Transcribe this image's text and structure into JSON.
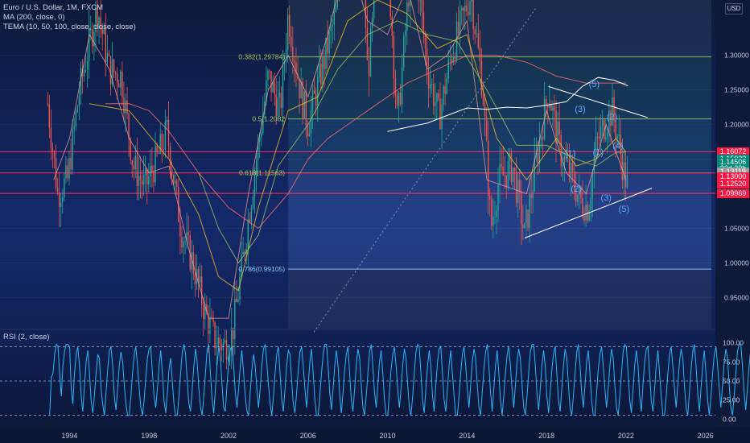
{
  "header": {
    "title": "Euro / U.S. Dollar, 1M, FXCM",
    "indicators": [
      "MA (200, close, 0)",
      "TEMA (10, 50, 100, close, close, close)"
    ],
    "currency": "USD"
  },
  "rsi_panel": {
    "label": "RSI (2, close)"
  },
  "colors": {
    "background": "#0d1a3a",
    "candle_up": "#26a69a",
    "candle_down": "#ef5350",
    "red_line": "#ff2b5e",
    "green_fib": "#9ccc65",
    "white_trend": "#ffffff",
    "rsi_line": "#29b6f6",
    "wave_label": "#5fa8ff"
  },
  "fib_labels": [
    {
      "text": "0.382(1.29784)",
      "price": 1.29784
    },
    {
      "text": "0.5(1.2082",
      "price": 1.2082
    },
    {
      "text": "0.618(1.11563)",
      "price": 1.1301
    },
    {
      "text": "0.786(0.99105)",
      "price": 0.99105
    }
  ],
  "price_tags": [
    {
      "text": "1.16072",
      "price": 1.16072,
      "bg": "#ff1744"
    },
    {
      "text": "1.15023",
      "price": 1.15023,
      "bg": "#00897b"
    },
    {
      "text": "1.14506",
      "price": 1.14506,
      "bg": "#00897b"
    },
    {
      "text": "23d 20h",
      "price": 1.1365,
      "bg": "#00897b"
    },
    {
      "text": "1.13119",
      "price": 1.13119,
      "bg": "#9e9e9e"
    },
    {
      "text": "1.13000",
      "price": 1.1243,
      "bg": "#ff1744"
    },
    {
      "text": "1.12520",
      "price": 1.1143,
      "bg": "#ff1744"
    },
    {
      "text": "1.09969",
      "price": 1.1005,
      "bg": "#ff1744"
    }
  ],
  "wave_labels": [
    {
      "text": "(5)",
      "x": 2020.4,
      "y": 1.254
    },
    {
      "text": "(3)",
      "x": 2019.7,
      "y": 1.218
    },
    {
      "text": "(2)",
      "x": 2021.3,
      "y": 1.207
    },
    {
      "text": "(1)",
      "x": 2019.2,
      "y": 1.154
    },
    {
      "text": "(1)",
      "x": 2020.6,
      "y": 1.156
    },
    {
      "text": "(4)",
      "x": 2021.6,
      "y": 1.165
    },
    {
      "text": "(2)",
      "x": 2019.5,
      "y": 1.103
    },
    {
      "text": "(3)",
      "x": 2021.0,
      "y": 1.09
    },
    {
      "text": "(5)",
      "x": 2021.9,
      "y": 1.074
    }
  ],
  "chart_data": [
    {
      "type": "candlestick",
      "title": "Euro / U.S. Dollar, 1M, FXCM",
      "xlim": [
        1990.5,
        2026.5
      ],
      "ylim": [
        0.905,
        1.38
      ],
      "x_ticks": [
        1994,
        1998,
        2002,
        2006,
        2010,
        2014,
        2018,
        2022,
        2026
      ],
      "y_ticks": [
        0.95,
        1.0,
        1.05,
        1.1,
        1.15,
        1.2,
        1.25,
        1.3
      ],
      "y_tick_labels": [
        "0.95000",
        "1.00000",
        "1.05000",
        "1.10000",
        "1.15000",
        "1.20000",
        "1.25000",
        "1.30000"
      ],
      "price_path": [
        [
          1992.9,
          1.23
        ],
        [
          1993.4,
          1.1
        ],
        [
          1993.9,
          1.12
        ],
        [
          1994.5,
          1.25
        ],
        [
          1995.1,
          1.33
        ],
        [
          1995.4,
          1.37
        ],
        [
          1996.0,
          1.28
        ],
        [
          1996.6,
          1.27
        ],
        [
          1997.2,
          1.14
        ],
        [
          1997.8,
          1.11
        ],
        [
          1998.4,
          1.15
        ],
        [
          1998.9,
          1.19
        ],
        [
          1999.6,
          1.05
        ],
        [
          2000.2,
          1.0
        ],
        [
          2000.8,
          0.93
        ],
        [
          2001.3,
          0.89
        ],
        [
          2001.8,
          0.88
        ],
        [
          2002.2,
          0.9
        ],
        [
          2002.7,
          1.0
        ],
        [
          2003.3,
          1.13
        ],
        [
          2004.0,
          1.27
        ],
        [
          2004.6,
          1.22
        ],
        [
          2005.0,
          1.36
        ],
        [
          2005.6,
          1.25
        ],
        [
          2006.0,
          1.2
        ],
        [
          2006.7,
          1.28
        ],
        [
          2007.4,
          1.36
        ],
        [
          2008.0,
          1.47
        ],
        [
          2008.6,
          1.57
        ],
        [
          2009.0,
          1.27
        ],
        [
          2009.6,
          1.45
        ],
        [
          2009.9,
          1.5
        ],
        [
          2010.5,
          1.2
        ],
        [
          2011.3,
          1.47
        ],
        [
          2012.0,
          1.28
        ],
        [
          2012.6,
          1.21
        ],
        [
          2013.2,
          1.3
        ],
        [
          2014.2,
          1.39
        ],
        [
          2014.8,
          1.25
        ],
        [
          2015.2,
          1.05
        ],
        [
          2015.6,
          1.12
        ],
        [
          2016.3,
          1.14
        ],
        [
          2016.9,
          1.04
        ],
        [
          2017.5,
          1.15
        ],
        [
          2018.1,
          1.25
        ],
        [
          2018.7,
          1.16
        ],
        [
          2019.3,
          1.12
        ],
        [
          2019.7,
          1.09
        ],
        [
          2020.1,
          1.08
        ],
        [
          2020.5,
          1.17
        ],
        [
          2020.9,
          1.2
        ],
        [
          2021.3,
          1.22
        ],
        [
          2021.6,
          1.18
        ],
        [
          2021.9,
          1.13
        ],
        [
          2022.1,
          1.11
        ]
      ],
      "ma200_path": [
        [
          1995.8,
          1.23
        ],
        [
          1997.0,
          1.23
        ],
        [
          1998.0,
          1.22
        ],
        [
          1999.0,
          1.19
        ],
        [
          2000.5,
          1.13
        ],
        [
          2002.0,
          1.08
        ],
        [
          2003.5,
          1.05
        ],
        [
          2005.0,
          1.1
        ],
        [
          2006.0,
          1.15
        ],
        [
          2007.0,
          1.18
        ],
        [
          2008.0,
          1.2
        ],
        [
          2009.5,
          1.23
        ],
        [
          2011.0,
          1.26
        ],
        [
          2012.5,
          1.28
        ],
        [
          2014.0,
          1.3
        ],
        [
          2015.5,
          1.3
        ],
        [
          2017.0,
          1.29
        ],
        [
          2018.5,
          1.27
        ],
        [
          2020.0,
          1.26
        ],
        [
          2021.0,
          1.26
        ],
        [
          2022.0,
          1.26
        ]
      ],
      "tema_paths": [
        [
          [
            1993.2,
            1.12
          ],
          [
            1994.0,
            1.18
          ],
          [
            1995.0,
            1.33
          ],
          [
            1996.0,
            1.28
          ],
          [
            1997.0,
            1.18
          ],
          [
            1998.0,
            1.13
          ],
          [
            1999.0,
            1.14
          ],
          [
            2000.0,
            1.02
          ],
          [
            2001.0,
            0.92
          ],
          [
            2002.0,
            0.92
          ],
          [
            2003.0,
            1.1
          ],
          [
            2004.0,
            1.25
          ],
          [
            2005.0,
            1.3
          ],
          [
            2006.0,
            1.24
          ],
          [
            2007.0,
            1.33
          ],
          [
            2008.0,
            1.45
          ],
          [
            2009.0,
            1.35
          ],
          [
            2010.0,
            1.33
          ],
          [
            2011.0,
            1.4
          ],
          [
            2012.0,
            1.28
          ],
          [
            2013.0,
            1.3
          ],
          [
            2014.0,
            1.35
          ],
          [
            2015.0,
            1.12
          ],
          [
            2016.0,
            1.11
          ],
          [
            2017.0,
            1.1
          ],
          [
            2018.0,
            1.22
          ],
          [
            2019.0,
            1.13
          ],
          [
            2020.0,
            1.1
          ],
          [
            2021.0,
            1.2
          ],
          [
            2022.0,
            1.12
          ]
        ],
        [
          [
            1995.0,
            1.23
          ],
          [
            1997.0,
            1.22
          ],
          [
            1999.0,
            1.15
          ],
          [
            2000.5,
            1.07
          ],
          [
            2001.5,
            0.98
          ],
          [
            2002.5,
            0.96
          ],
          [
            2003.5,
            1.08
          ],
          [
            2005.0,
            1.22
          ],
          [
            2006.5,
            1.24
          ],
          [
            2008.0,
            1.35
          ],
          [
            2009.5,
            1.38
          ],
          [
            2011.0,
            1.36
          ],
          [
            2012.5,
            1.31
          ],
          [
            2014.0,
            1.33
          ],
          [
            2015.5,
            1.18
          ],
          [
            2017.0,
            1.12
          ],
          [
            2018.5,
            1.18
          ],
          [
            2019.5,
            1.14
          ],
          [
            2020.5,
            1.15
          ],
          [
            2021.5,
            1.18
          ],
          [
            2022.0,
            1.16
          ]
        ],
        [
          [
            2000.5,
            1.13
          ],
          [
            2001.5,
            1.05
          ],
          [
            2002.5,
            1.0
          ],
          [
            2003.5,
            1.04
          ],
          [
            2004.5,
            1.14
          ],
          [
            2006.0,
            1.2
          ],
          [
            2007.5,
            1.28
          ],
          [
            2009.0,
            1.33
          ],
          [
            2010.5,
            1.35
          ],
          [
            2012.0,
            1.33
          ],
          [
            2013.5,
            1.32
          ],
          [
            2015.0,
            1.25
          ],
          [
            2016.5,
            1.17
          ],
          [
            2018.0,
            1.17
          ],
          [
            2019.5,
            1.15
          ],
          [
            2020.5,
            1.14
          ],
          [
            2021.5,
            1.16
          ],
          [
            2022.0,
            1.16
          ]
        ]
      ],
      "horizontal_levels": [
        {
          "price": 1.29784,
          "role": "fib-0.382"
        },
        {
          "price": 1.2082,
          "role": "fib-0.5"
        },
        {
          "price": 1.1301,
          "role": "fib-0.618"
        },
        {
          "price": 0.99105,
          "role": "fib-0.786"
        },
        {
          "price": 1.16072,
          "role": "red-level"
        },
        {
          "price": 1.1301,
          "role": "red-level"
        },
        {
          "price": 1.1005,
          "role": "red-level"
        }
      ],
      "fib_zones": [
        {
          "from": 1.38,
          "to": 1.29784
        },
        {
          "from": 1.29784,
          "to": 1.2082
        },
        {
          "from": 1.2082,
          "to": 1.1301
        },
        {
          "from": 1.1301,
          "to": 0.99105
        },
        {
          "from": 0.99105,
          "to": 0.905
        }
      ],
      "fib_x_range": [
        2005.0,
        2026.3
      ],
      "trend_lines": [
        {
          "from": [
            2016.9,
            1.036
          ],
          "to": [
            2023.3,
            1.108
          ]
        },
        {
          "from": [
            2018.1,
            1.255
          ],
          "to": [
            2023.1,
            1.21
          ]
        }
      ],
      "white_curves": [
        [
          [
            2010.0,
            1.19
          ],
          [
            2011.0,
            1.196
          ],
          [
            2012.0,
            1.202
          ],
          [
            2013.0,
            1.213
          ],
          [
            2014.0,
            1.224
          ],
          [
            2015.0,
            1.222
          ],
          [
            2016.0,
            1.225
          ],
          [
            2017.0,
            1.224
          ],
          [
            2018.0,
            1.228
          ],
          [
            2019.0,
            1.233
          ],
          [
            2019.8,
            1.255
          ],
          [
            2020.6,
            1.268
          ],
          [
            2021.4,
            1.264
          ],
          [
            2022.1,
            1.256
          ]
        ]
      ],
      "dashed_trend": {
        "from": [
          2006.3,
          0.9
        ],
        "to": [
          2017.5,
          1.37
        ]
      }
    },
    {
      "type": "line",
      "title": "RSI (2, close)",
      "xlim": [
        1990.5,
        2026.5
      ],
      "ylim": [
        -8,
        108
      ],
      "y_ticks": [
        0.0,
        25.0,
        50.0,
        75.0,
        100.0
      ],
      "y_tick_labels": [
        "0.00",
        "25.00",
        "50.00",
        "75.00",
        "100.00"
      ],
      "dashed_levels": [
        5,
        50,
        95
      ],
      "x_start": 1993.0,
      "x_step": 0.0834,
      "values": [
        5,
        55,
        60,
        85,
        98,
        96,
        60,
        30,
        70,
        90,
        98,
        98,
        95,
        40,
        20,
        60,
        85,
        95,
        70,
        30,
        10,
        45,
        75,
        90,
        60,
        25,
        8,
        30,
        60,
        85,
        80,
        40,
        20,
        5,
        35,
        65,
        90,
        95,
        70,
        30,
        12,
        40,
        70,
        88,
        75,
        45,
        20,
        5,
        5,
        30,
        60,
        85,
        95,
        70,
        40,
        15,
        5,
        25,
        55,
        80,
        92,
        95,
        60,
        30,
        15,
        40,
        70,
        90,
        60,
        25,
        8,
        35,
        65,
        80,
        50,
        20,
        5,
        5,
        30,
        60,
        88,
        98,
        85,
        50,
        20,
        10,
        40,
        70,
        92,
        75,
        40,
        15,
        5,
        30,
        60,
        90,
        98,
        60,
        25,
        8,
        40,
        70,
        95,
        80,
        45,
        15,
        10,
        45,
        75,
        92,
        95,
        70,
        35,
        15,
        40,
        70,
        90,
        60,
        30,
        10,
        5,
        35,
        65,
        85,
        70,
        40,
        15,
        40,
        70,
        92,
        98,
        75,
        45,
        20,
        5,
        30,
        60,
        85,
        95,
        60,
        25,
        10,
        40,
        70,
        90,
        85,
        50,
        20,
        8,
        35,
        65,
        88,
        95,
        70,
        40,
        15,
        45,
        75,
        92,
        60,
        25,
        5,
        5,
        30,
        60,
        85,
        98,
        98,
        70,
        35,
        12,
        40,
        70,
        90,
        70,
        30,
        8,
        35,
        65,
        85,
        95,
        60,
        25,
        10,
        40,
        70,
        92,
        80,
        45,
        15,
        5,
        30,
        60,
        88,
        98,
        70,
        35,
        15,
        45,
        75,
        90,
        60,
        25,
        5,
        5,
        35,
        65,
        85,
        95,
        70,
        40,
        15,
        40,
        70,
        92,
        80,
        45,
        15,
        5,
        30,
        60,
        88,
        98,
        95,
        60,
        25,
        8,
        40,
        70,
        90,
        70,
        30,
        10,
        45,
        75,
        92,
        95,
        60,
        25,
        10,
        40,
        70,
        90,
        60,
        30,
        5,
        5,
        30,
        60,
        85,
        95,
        70,
        40,
        15,
        45,
        75,
        92,
        80,
        45,
        15,
        5,
        35,
        65,
        88,
        98,
        70,
        35,
        10,
        40,
        70,
        90,
        60,
        25,
        5,
        30,
        60,
        85,
        95,
        70,
        40,
        15,
        45,
        75,
        92,
        80,
        45,
        15,
        5,
        30,
        60,
        88,
        98,
        98,
        70,
        35,
        12,
        40,
        70,
        90,
        70,
        30,
        8,
        35,
        65,
        85,
        95,
        60,
        25,
        10,
        40,
        70,
        92,
        80,
        45,
        15,
        5,
        30,
        60,
        88,
        98,
        70,
        35,
        15,
        45,
        75,
        90,
        60,
        25,
        5,
        5,
        35,
        65,
        85,
        95,
        70,
        40,
        15,
        40,
        70,
        92,
        80,
        45,
        15,
        5,
        30,
        60,
        88,
        98,
        95,
        60,
        25,
        8,
        40,
        70,
        90,
        70,
        30,
        10,
        45,
        75,
        92,
        95,
        60,
        25,
        10,
        40,
        70,
        90,
        60,
        30,
        5,
        5,
        30,
        60,
        85,
        95,
        70,
        40,
        15,
        45,
        75,
        92,
        80,
        45,
        15,
        5,
        35,
        65,
        88,
        98,
        70,
        35,
        10,
        40,
        70,
        90,
        60,
        25,
        5,
        30,
        60,
        85,
        95,
        70,
        40,
        15,
        45,
        75,
        92,
        80,
        45,
        15,
        5,
        30,
        60,
        88,
        98,
        98,
        70,
        35,
        12,
        40,
        70,
        90,
        70,
        30,
        8,
        35,
        65,
        85,
        95,
        60,
        25,
        10,
        40,
        70,
        92,
        80,
        45,
        15,
        5,
        5,
        40,
        70
      ]
    }
  ]
}
